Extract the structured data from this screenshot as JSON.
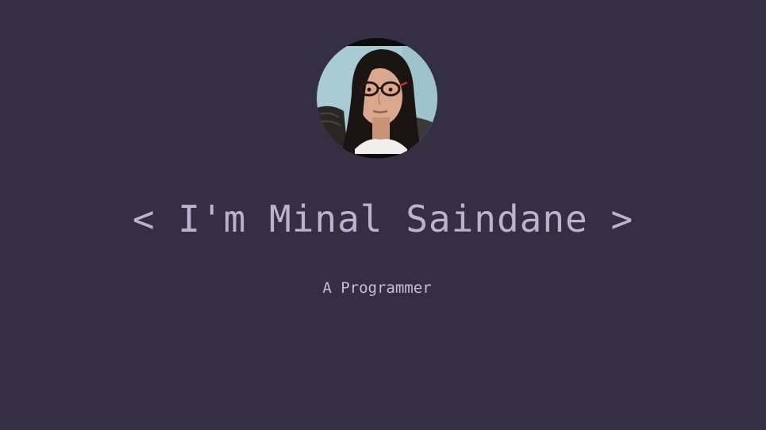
{
  "hero": {
    "title": "< I'm Minal Saindane >",
    "subtitle": "A Programmer"
  },
  "colors": {
    "background": "#352f44",
    "title": "#b9b4cf",
    "subtitle": "#c4bfd6"
  }
}
